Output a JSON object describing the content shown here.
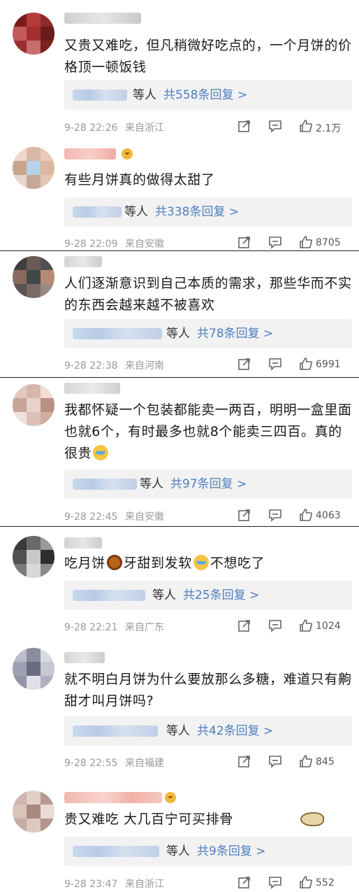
{
  "reply_label": "等人",
  "comments": [
    {
      "text": "又贵又难吃，但凡稍微好吃点的，一个月饼的价格顶一顿饭钱",
      "reply_count": "共558条回复 >",
      "time": "9-28 22:26",
      "location": "来自浙江",
      "likes": "2.1万",
      "avatar_colors": [
        "#7a1b1b",
        "#b53a3a",
        "#8e2a2a",
        "#c45a5a",
        "#a33030",
        "#6b1a1a",
        "#9a2d2d",
        "#c86d6d",
        "#7d2222"
      ]
    },
    {
      "text": "有些月饼真的做得太甜了",
      "reply_count": "共338条回复 >",
      "time": "9-28 22:09",
      "location": "来自安徽",
      "likes": "8705",
      "avatar_colors": [
        "#f0d6c8",
        "#d9b9a5",
        "#e8c8b8",
        "#c8a590",
        "#b7d2e6",
        "#dcb6a0",
        "#e9d5cb",
        "#c6a898",
        "#e5c7b6"
      ]
    },
    {
      "text": "人们逐渐意识到自己本质的需求，那些华而不实的东西会越来越不被喜欢",
      "reply_count": "共78条回复 >",
      "time": "9-28 22:38",
      "location": "来自河南",
      "likes": "6991",
      "avatar_colors": [
        "#3f3f3f",
        "#6a5a58",
        "#505050",
        "#8a6a60",
        "#404848",
        "#b58a78",
        "#5a5454",
        "#7b6a66",
        "#9c8880"
      ]
    },
    {
      "text": "我都怀疑一个包装都能卖一两百，明明一盒里面也就6个，有时最多也就8个能卖三四百。真的很贵",
      "reply_count": "共97条回复 >",
      "time": "9-28 22:45",
      "location": "来自安徽",
      "likes": "4063",
      "avatar_colors": [
        "#e2c9bf",
        "#d6b7aa",
        "#f0ddd5",
        "#c9a597",
        "#e8d2c8",
        "#b99283",
        "#efe0da",
        "#dcc1b6",
        "#cfae9f"
      ]
    },
    {
      "text": "吃月饼牙甜到发软不想吃了",
      "reply_count": "共25条回复 >",
      "time": "9-28 22:21",
      "location": "来自广东",
      "likes": "1024",
      "avatar_colors": [
        "#3a3a3a",
        "#6a6a6a",
        "#9a9a9a",
        "#505050",
        "#c8c8c8",
        "#2e2e2e",
        "#7a7a7a",
        "#d8d8d8",
        "#8a8a8a"
      ]
    },
    {
      "text": "就不明白月饼为什么要放那么多糖，难道只有齁甜才叫月饼吗?",
      "reply_count": "共42条回复 >",
      "time": "9-28 22:55",
      "location": "来自福建",
      "likes": "845",
      "avatar_colors": [
        "#bcbcc8",
        "#8c8ca0",
        "#d8d8e0",
        "#a0a0b4",
        "#6c6c80",
        "#c8c8d4",
        "#9494a8",
        "#e0e0e8",
        "#b0b0c0"
      ]
    },
    {
      "text": "贵又难吃 大几百宁可买排骨",
      "reply_count": "共9条回复 >",
      "time": "9-28 23:47",
      "location": "来自浙江",
      "likes": "552",
      "avatar_colors": [
        "#cdb7ae",
        "#e2d0c8",
        "#b89a8e",
        "#d9c4ba",
        "#a88a80",
        "#eadcd5",
        "#c4aca2",
        "#dcc8c0",
        "#b2968c"
      ]
    }
  ]
}
